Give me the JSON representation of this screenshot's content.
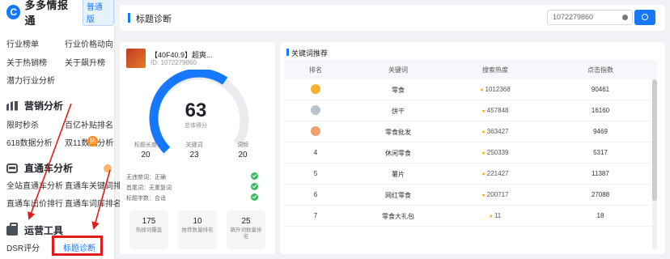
{
  "app": {
    "logo_glyph": "C",
    "name": "多多情报通",
    "plan": "普通版"
  },
  "sidebar": {
    "links": [
      {
        "label": "行业榜单",
        "name": "link-industry-rank"
      },
      {
        "label": "行业价格动向",
        "name": "link-industry-price"
      },
      {
        "label": "关于热销榜",
        "name": "link-hot-sales"
      },
      {
        "label": "关于飙升榜",
        "name": "link-rising"
      },
      {
        "label": "潜力行业分析",
        "name": "link-potential-industry"
      }
    ],
    "sections": [
      {
        "title": "营销分析",
        "icon": "bar-chart-icon",
        "items": [
          "限时秒杀",
          "百亿补贴排名",
          "618数据分析",
          "双11数据分析"
        ]
      },
      {
        "title": "直通车分析",
        "icon": "bus-icon",
        "items": [
          "全站直通车分析",
          "直通车关键词排名",
          "直通车出价排行",
          "直通车词库排名"
        ]
      },
      {
        "title": "运营工具",
        "icon": "toolbox-icon",
        "items": [
          "DSR评分",
          "标题诊断"
        ]
      }
    ],
    "hot_badge": "热"
  },
  "header": {
    "title": "标题诊断",
    "search_value": "1072279860"
  },
  "product": {
    "title": "【40F40.9】超爽...",
    "id": "ID: 1072279860",
    "score": "63",
    "score_label": "总体得分",
    "score_fraction": 0.63,
    "stats": [
      {
        "label": "标题长度",
        "value": "20"
      },
      {
        "label": "关键词",
        "value": "23"
      },
      {
        "label": "词频",
        "value": "20"
      }
    ],
    "checks": [
      "无违禁词：正确",
      "首尾词：无重复词",
      "标题字数：合适"
    ],
    "boxes": [
      {
        "value": "175",
        "label": "热搜词覆盖"
      },
      {
        "value": "10",
        "label": "推荐数量排名"
      },
      {
        "value": "25",
        "label": "飙升词数量排名"
      }
    ]
  },
  "keywords": {
    "title": "关键词推荐",
    "columns": [
      "排名",
      "关键词",
      "搜索热度",
      "点击指数"
    ],
    "rows": [
      {
        "rank": "1",
        "medal": "#f2b230",
        "keyword": "零食",
        "heat": "1012368",
        "clicks": "90461"
      },
      {
        "rank": "2",
        "medal": "#b8c2cf",
        "keyword": "饼干",
        "heat": "457848",
        "clicks": "16160"
      },
      {
        "rank": "3",
        "medal": "#f0a070",
        "keyword": "零食批发",
        "heat": "363427",
        "clicks": "9469"
      },
      {
        "rank": "4",
        "keyword": "休闲零食",
        "heat": "250339",
        "clicks": "5317"
      },
      {
        "rank": "5",
        "keyword": "薯片",
        "heat": "221427",
        "clicks": "11387"
      },
      {
        "rank": "6",
        "keyword": "网红零食",
        "heat": "200717",
        "clicks": "27088"
      },
      {
        "rank": "7",
        "keyword": "零食大礼包",
        "heat": "11",
        "clicks": "18"
      }
    ]
  },
  "colors": {
    "accent": "#1677ff",
    "highlight": "#e01b1b",
    "ok": "#3cbc60"
  }
}
